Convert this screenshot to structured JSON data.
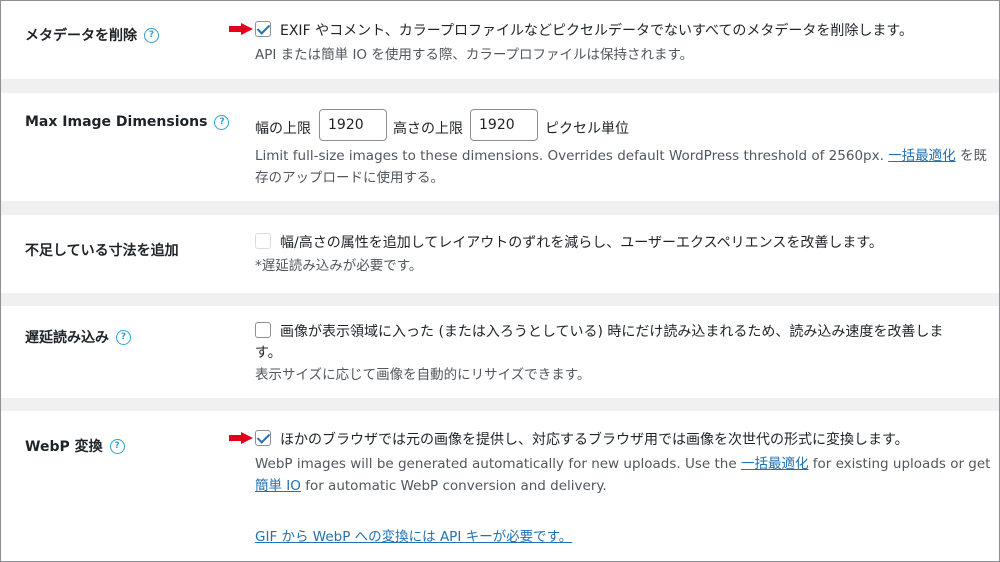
{
  "settings": {
    "strip_metadata": {
      "label": "メタデータを削除",
      "checked": true,
      "text": "EXIF やコメント、カラープロファイルなどピクセルデータでないすべてのメタデータを削除します。",
      "desc": "API または簡単 IO を使用する際、カラープロファイルは保持されます。"
    },
    "max_dimensions": {
      "label": "Max Image Dimensions",
      "width_label": "幅の上限",
      "width_value": "1920",
      "height_label": "高さの上限",
      "height_value": "1920",
      "unit_label": "ピクセル単位",
      "desc_part1": "Limit full-size images to these dimensions. Overrides default WordPress threshold of 2560px.",
      "desc_link": "一括最適化",
      "desc_part2": "を既",
      "desc_line2": "存のアップロードに使用する。"
    },
    "add_dimensions": {
      "label": "不足している寸法を追加",
      "checked": false,
      "disabled": true,
      "text": "幅/高さの属性を追加してレイアウトのずれを減らし、ユーザーエクスペリエンスを改善します。",
      "desc": "*遅延読み込みが必要です。"
    },
    "lazy_load": {
      "label": "遅延読み込み",
      "checked": false,
      "text_line1": "画像が表示領域に入った (または入ろうとしている) 時にだけ読み込まれるため、読み込み速度を改善しま",
      "text_line2": "す。",
      "desc": "表示サイズに応じて画像を自動的にリサイズできます。"
    },
    "webp": {
      "label": "WebP 変換",
      "checked": true,
      "text": "ほかのブラウザでは元の画像を提供し、対応するブラウザ用では画像を次世代の形式に変換します。",
      "desc_part1": "WebP images will be generated automatically for new uploads. Use the",
      "desc_link1": "一括最適化",
      "desc_part2": "for existing uploads or get",
      "desc_link2": "簡単 IO",
      "desc_part3": "for automatic WebP conversion and delivery.",
      "api_link": "GIF から WebP への変換には API キーが必要です。"
    }
  },
  "help_icon": "question-circle-icon",
  "colors": {
    "accent": "#2271b1",
    "help": "#2ea2cc",
    "annotation_arrow": "#e3001b"
  }
}
